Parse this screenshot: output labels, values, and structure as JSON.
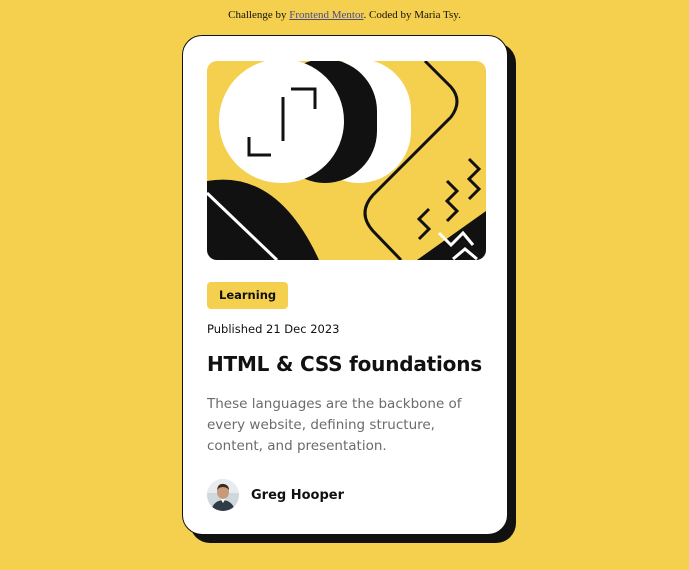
{
  "attribution": {
    "prefix": "Challenge by ",
    "link_text": "Frontend Mentor",
    "suffix": ". Coded by Maria Tsy."
  },
  "card": {
    "tag": "Learning",
    "published": "Published 21 Dec 2023",
    "title": "HTML & CSS foundations",
    "description": "These languages are the backbone of every website, defining structure, content, and presentation.",
    "author": {
      "name": "Greg Hooper"
    }
  },
  "colors": {
    "background": "#f4d04e",
    "card": "#ffffff",
    "ink": "#111111",
    "muted_text": "#6b6b6b",
    "tag": "#f4d04e"
  },
  "icons": {
    "hero": "abstract-illustration",
    "avatar": "person-avatar"
  }
}
